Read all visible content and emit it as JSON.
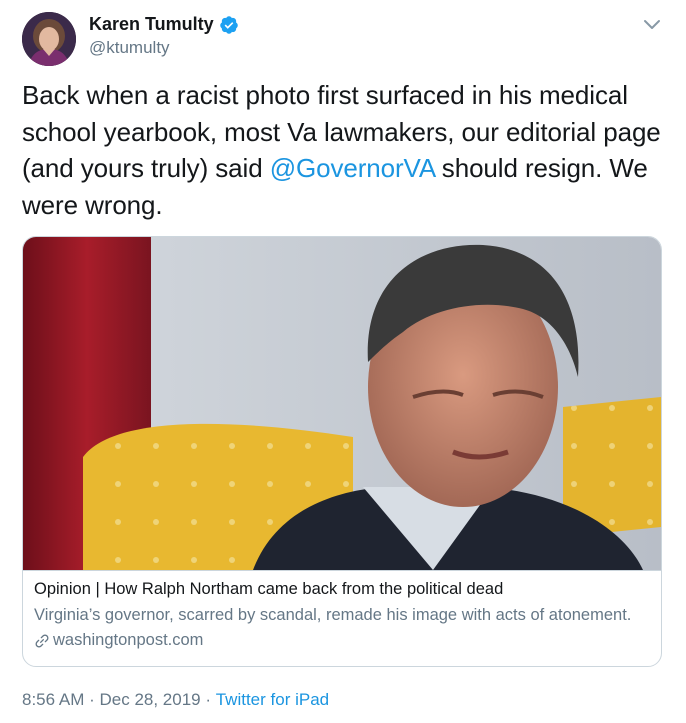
{
  "author": {
    "display_name": "Karen Tumulty",
    "handle": "@ktumulty"
  },
  "tweet": {
    "text_before": "Back when a racist photo first surfaced in his medical school yearbook, most Va lawmakers, our editorial page (and yours truly) said ",
    "mention": "@GovernorVA",
    "text_after": " should resign. We were wrong."
  },
  "card": {
    "title": "Opinion | How Ralph Northam came back from the political dead",
    "description": "Virginia’s governor, scarred by scandal, remade his image with acts of atonement.",
    "domain": "washingtonpost.com"
  },
  "footer": {
    "time": "8:56 AM",
    "separator": " · ",
    "date": "Dec 28, 2019",
    "separator2": " · ",
    "source": "Twitter for iPad"
  },
  "icons": {
    "verified": "verified-badge-icon",
    "caret": "chevron-down-icon",
    "link": "link-icon"
  },
  "colors": {
    "link_blue": "#1b95e0",
    "secondary_text": "#657786",
    "border": "#ccd6dd"
  }
}
